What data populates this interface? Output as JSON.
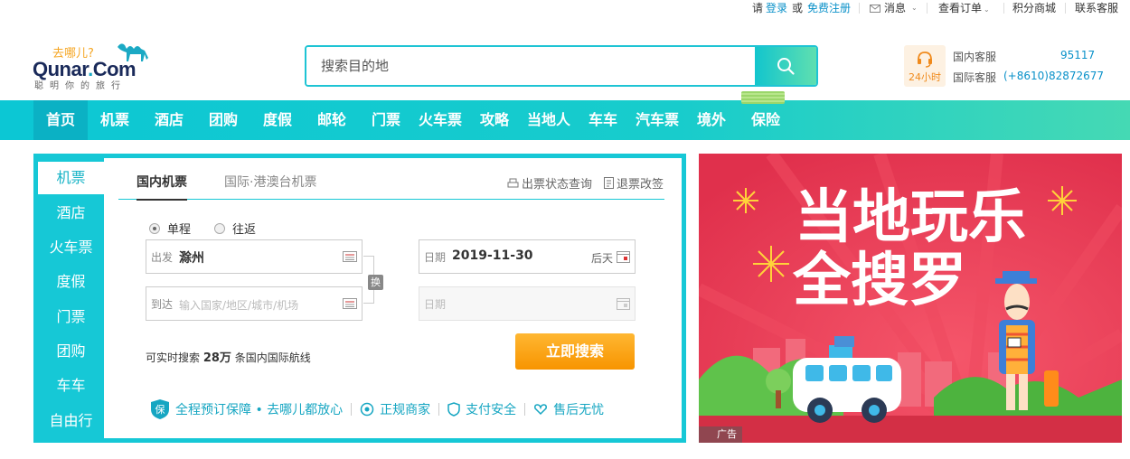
{
  "topbar": {
    "please": "请",
    "login": "登录",
    "or": "或",
    "register": "免费注册",
    "messages": "消息",
    "orders": "查看订单",
    "points": "积分商城",
    "contact": "联系客服"
  },
  "logo": {
    "slogan_top": "去哪儿?",
    "brand_main": "Qunar",
    "brand_dot": ".",
    "brand_com": "Com",
    "slogan_bottom": "聪明你的旅行"
  },
  "search": {
    "placeholder": "搜索目的地"
  },
  "service": {
    "badge": "24小时",
    "domestic_label": "国内客服",
    "domestic_number": "95117",
    "intl_label": "国际客服",
    "intl_number": "(+8610)82872677"
  },
  "nav": {
    "items": [
      "首页",
      "机票",
      "酒店",
      "团购",
      "度假",
      "邮轮",
      "门票",
      "火车票",
      "攻略",
      "当地人",
      "车车",
      "汽车票",
      "境外",
      "保险"
    ],
    "active_index": 0
  },
  "booking": {
    "side": [
      "机票",
      "酒店",
      "火车票",
      "度假",
      "门票",
      "团购",
      "车车",
      "自由行"
    ],
    "side_active": 0,
    "tabs": [
      "国内机票",
      "国际·港澳台机票"
    ],
    "tab_active": 0,
    "links": {
      "status": "出票状态查询",
      "refund": "退票改签"
    },
    "trip": {
      "oneway": "单程",
      "round": "往返",
      "selected": "oneway"
    },
    "from": {
      "label": "出发",
      "value": "滁州"
    },
    "to": {
      "label": "到达",
      "placeholder": "输入国家/地区/城市/机场"
    },
    "swap": "换",
    "date": {
      "label": "日期",
      "value": "2019-11-30",
      "hint": "后天"
    },
    "return_date": {
      "label": "日期"
    },
    "routes_prefix": "可实时搜索",
    "routes_count": "28万",
    "routes_suffix": "条国内国际航线",
    "search_button": "立即搜索"
  },
  "assurance": {
    "main": "全程预订保障 • 去哪儿都放心",
    "items": [
      "正规商家",
      "支付安全",
      "售后无忧"
    ]
  },
  "ad": {
    "headline_1": "当地玩乐",
    "headline_2": "全搜罗",
    "label": "广告"
  },
  "colors": {
    "accent": "#16c8d6",
    "link": "#0a91c9",
    "orange": "#f79400",
    "ad_bg": "#e83a52"
  }
}
